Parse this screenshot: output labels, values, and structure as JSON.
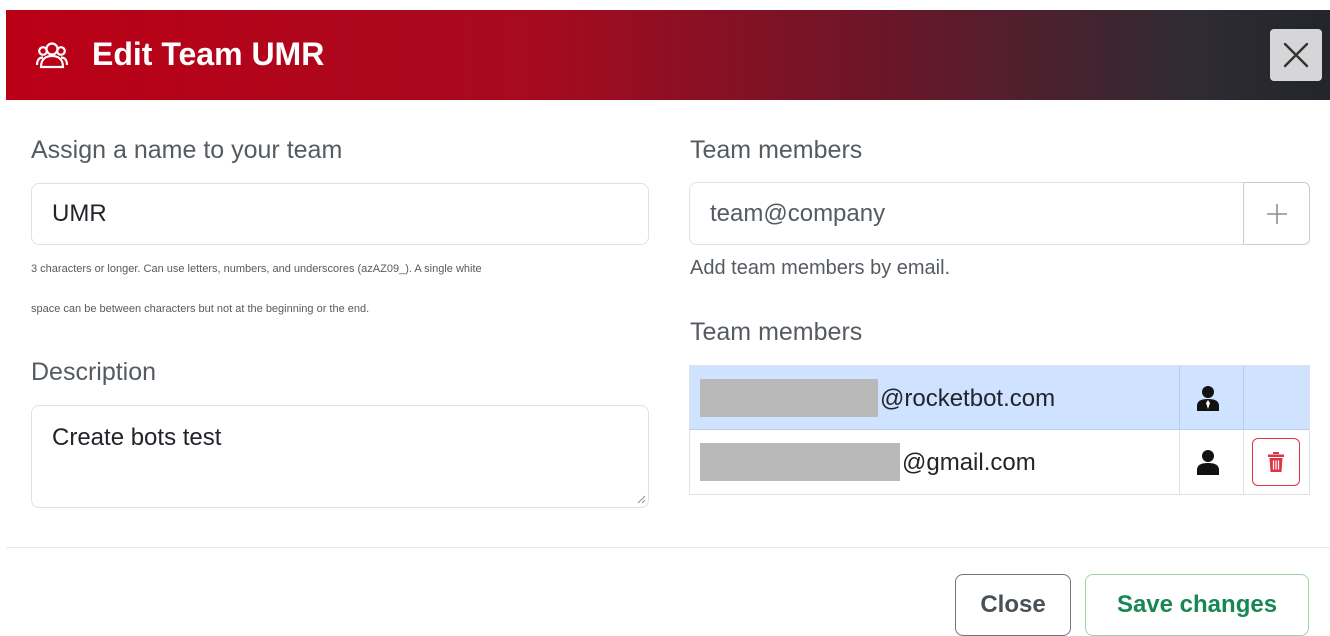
{
  "header": {
    "icon": "team-users-icon",
    "title": "Edit Team UMR",
    "close_icon": "close-x-icon"
  },
  "team_name": {
    "label": "Assign a name to your team",
    "value": "UMR",
    "help_line1": "3 characters or longer. Can use letters, numbers, and underscores (azAZ09_). A single white",
    "help_line2": "space can be between characters but not at the beginning or the end."
  },
  "description": {
    "label": "Description",
    "value": "Create bots test"
  },
  "add_members": {
    "label": "Team members",
    "placeholder": "team@company",
    "add_icon": "plus-icon",
    "help": "Add team members by email."
  },
  "members": {
    "label": "Team members",
    "rows": [
      {
        "email_domain": "@rocketbot.com",
        "role_icon": "admin-user-icon",
        "highlighted": true,
        "deletable": false
      },
      {
        "email_domain": "@gmail.com",
        "role_icon": "user-icon",
        "highlighted": false,
        "deletable": true,
        "delete_icon": "trash-icon"
      }
    ]
  },
  "footer": {
    "close_label": "Close",
    "save_label": "Save changes"
  },
  "colors": {
    "header_start": "#bb0016",
    "header_end": "#23262b",
    "highlight_row": "#cfe2ff",
    "danger": "#dc3545",
    "success": "#198754"
  }
}
